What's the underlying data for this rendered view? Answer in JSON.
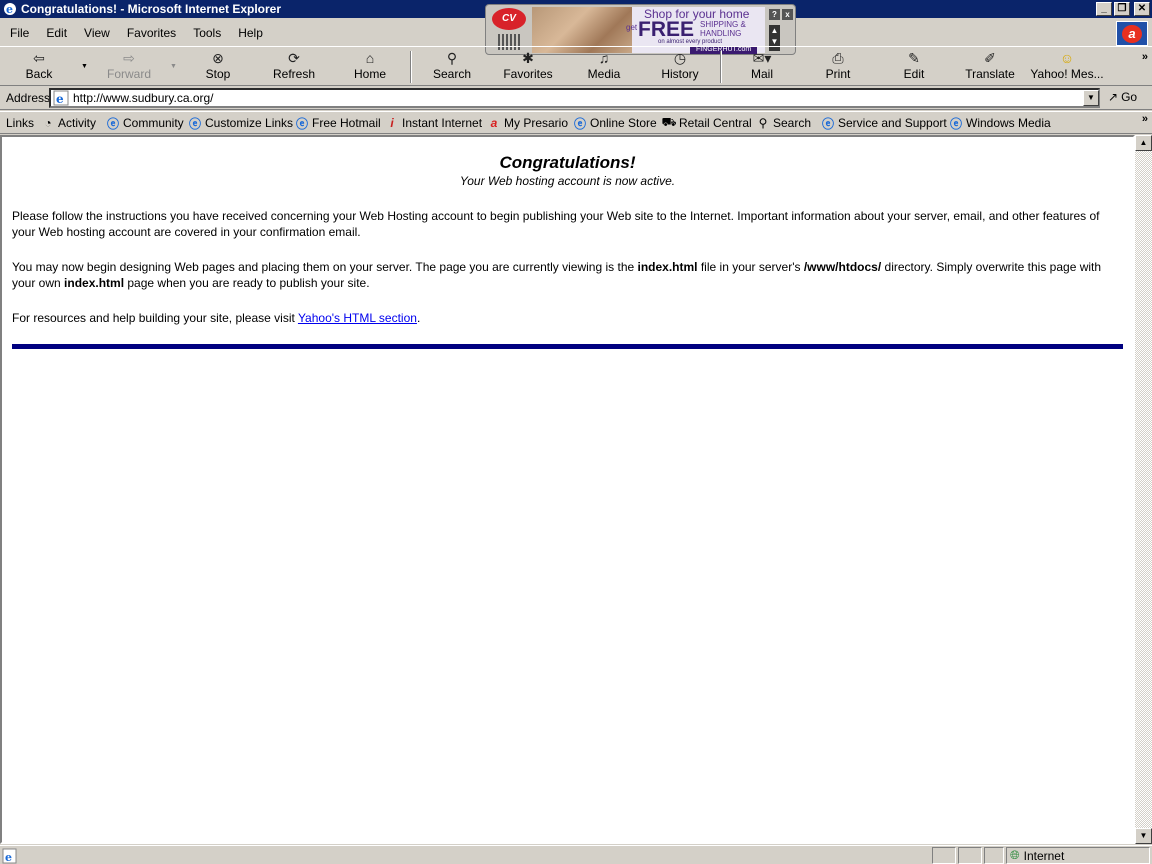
{
  "window": {
    "title": "Congratulations! - Microsoft Internet Explorer"
  },
  "menu": [
    "File",
    "Edit",
    "View",
    "Favorites",
    "Tools",
    "Help"
  ],
  "ad": {
    "logo": "CV",
    "headline": "Shop for your home",
    "get": "get",
    "free": "FREE",
    "shipping": "SHIPPING &\nHANDLING",
    "small": "on almost every product",
    "brand": "FINGERHUT.com",
    "help": "?",
    "close": "x"
  },
  "toolbar": {
    "back": "Back",
    "forward": "Forward",
    "stop": "Stop",
    "refresh": "Refresh",
    "home": "Home",
    "search": "Search",
    "favorites": "Favorites",
    "media": "Media",
    "history": "History",
    "mail": "Mail",
    "print": "Print",
    "edit": "Edit",
    "translate": "Translate",
    "yahoo": "Yahoo! Mes..."
  },
  "address": {
    "label": "Address",
    "url": "http://www.sudbury.ca.org/",
    "go": "Go"
  },
  "links": {
    "label": "Links",
    "items": [
      "Activity",
      "Community",
      "Customize Links",
      "Free Hotmail",
      "Instant Internet",
      "My Presario",
      "Online Store",
      "Retail Central",
      "Search",
      "Service and Support",
      "Windows Media"
    ]
  },
  "page": {
    "title": "Congratulations!",
    "subtitle": "Your Web hosting account is now active.",
    "p1": "Please follow the instructions you have received concerning your Web Hosting account to begin publishing your Web site to the Internet.  Important information about your server, email, and other features of your Web hosting account are covered in your confirmation email.",
    "p2_a": "You may now begin designing Web pages and placing them on your server. The page you are currently viewing is the ",
    "p2_b": "index.html",
    "p2_c": " file in your server's ",
    "p2_d": "/www/htdocs/",
    "p2_e": " directory. Simply overwrite this page with your own ",
    "p2_f": "index.html",
    "p2_g": " page when you are ready to publish your site.",
    "p3_a": "For resources and help building your site, please visit ",
    "p3_link": "Yahoo's HTML section",
    "p3_b": "."
  },
  "status": {
    "zone": "Internet"
  },
  "colors": {
    "titlebar": "#0a246a",
    "chrome": "#d4d0c8",
    "rule": "#000080",
    "link": "#0000ee"
  }
}
